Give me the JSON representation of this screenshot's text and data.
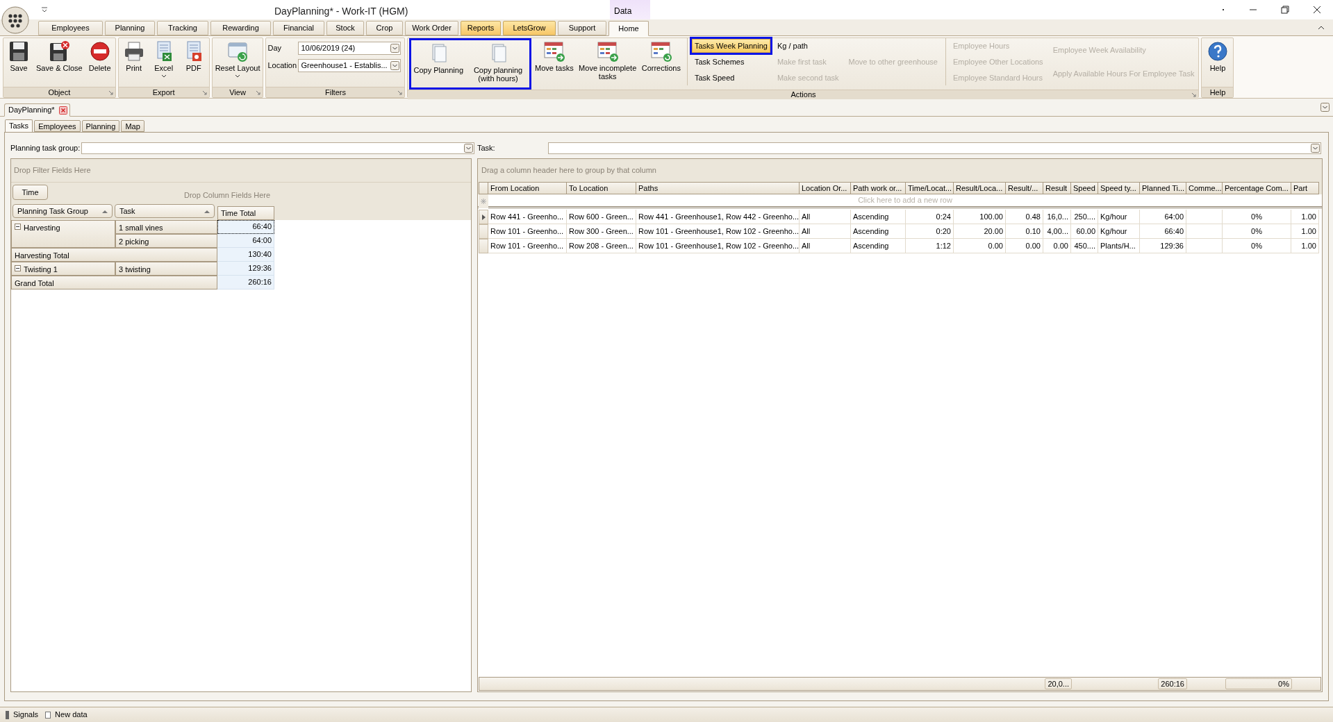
{
  "window": {
    "title": "DayPlanning* - Work-IT (HGM)",
    "context_label": "Data"
  },
  "ribbon_tabs": [
    {
      "label": "Employees",
      "selected": false,
      "highlighted": false
    },
    {
      "label": "Planning",
      "selected": false,
      "highlighted": false
    },
    {
      "label": "Tracking",
      "selected": false,
      "highlighted": false
    },
    {
      "label": "Rewarding",
      "selected": false,
      "highlighted": false
    },
    {
      "label": "Financial",
      "selected": false,
      "highlighted": false
    },
    {
      "label": "Stock",
      "selected": false,
      "highlighted": false
    },
    {
      "label": "Crop",
      "selected": false,
      "highlighted": false
    },
    {
      "label": "Work Order",
      "selected": false,
      "highlighted": false
    },
    {
      "label": "Reports",
      "selected": false,
      "highlighted": true
    },
    {
      "label": "LetsGrow",
      "selected": false,
      "highlighted": true
    },
    {
      "label": "Support",
      "selected": false,
      "highlighted": false
    },
    {
      "label": "Home",
      "selected": true,
      "highlighted": false
    }
  ],
  "ribbon_groups": [
    {
      "caption": "Object",
      "buttons": [
        {
          "label": "Save",
          "kind": "save",
          "dropdown": false,
          "outlined": false
        },
        {
          "label": "Save & Close",
          "kind": "saveclose",
          "dropdown": false,
          "outlined": false
        },
        {
          "label": "Delete",
          "kind": "delete",
          "dropdown": false,
          "outlined": false
        }
      ]
    },
    {
      "caption": "Export",
      "buttons": [
        {
          "label": "Print",
          "kind": "print",
          "dropdown": false,
          "outlined": false
        },
        {
          "label": "Excel",
          "kind": "excel",
          "dropdown": true,
          "outlined": false
        },
        {
          "label": "PDF",
          "kind": "pdf",
          "dropdown": false,
          "outlined": false
        }
      ]
    },
    {
      "caption": "View",
      "buttons": [
        {
          "label": "Reset Layout",
          "kind": "reset",
          "dropdown": true,
          "outlined": false
        }
      ]
    },
    {
      "caption": "Filters",
      "fields": [
        {
          "label": "Day",
          "value": "10/06/2019 (24)"
        },
        {
          "label": "Location",
          "value": "Greenhouse1 - Establis..."
        }
      ]
    },
    {
      "caption": "Actions",
      "buttons": [
        {
          "label": "Copy Planning",
          "kind": "copy",
          "dropdown": false,
          "outlined": true
        },
        {
          "label": "Copy planning (with hours)",
          "kind": "copy",
          "dropdown": false,
          "outlined": true
        },
        {
          "label": "Move tasks",
          "kind": "move",
          "dropdown": false,
          "outlined": false
        },
        {
          "label": "Move incomplete tasks",
          "kind": "move",
          "dropdown": false,
          "outlined": false
        },
        {
          "label": "Corrections",
          "kind": "correct",
          "dropdown": false,
          "outlined": false
        }
      ],
      "sections": [
        {
          "columns": [
            [
              {
                "label": "Tasks Week Planning",
                "disabled": false,
                "highlighted": true,
                "outlined": true
              },
              {
                "label": "Task Schemes",
                "disabled": false,
                "highlighted": false,
                "outlined": false
              },
              {
                "label": "Task Speed",
                "disabled": false,
                "highlighted": false,
                "outlined": false
              }
            ],
            [
              {
                "label": "Kg / path",
                "disabled": false,
                "highlighted": false,
                "outlined": false
              },
              {
                "label": "Make first task",
                "disabled": true,
                "highlighted": false,
                "outlined": false
              },
              {
                "label": "Make second task",
                "disabled": true,
                "highlighted": false,
                "outlined": false
              }
            ],
            [
              {
                "label": "Move to other greenhouse",
                "disabled": true,
                "highlighted": false,
                "outlined": false
              }
            ]
          ]
        },
        {
          "columns": [
            [
              {
                "label": "Employee Hours",
                "disabled": true,
                "highlighted": false,
                "outlined": false
              },
              {
                "label": "Employee Other Locations",
                "disabled": true,
                "highlighted": false,
                "outlined": false
              },
              {
                "label": "Employee Standard Hours",
                "disabled": true,
                "highlighted": false,
                "outlined": false
              }
            ],
            [
              {
                "label": "Employee Week Availability",
                "disabled": true,
                "highlighted": false,
                "outlined": false
              },
              {
                "label": "Apply Available Hours For Employee Task",
                "disabled": true,
                "highlighted": false,
                "outlined": false
              }
            ]
          ]
        }
      ]
    },
    {
      "caption": "Help",
      "buttons": [
        {
          "label": "Help",
          "kind": "help",
          "dropdown": false,
          "outlined": false
        }
      ]
    }
  ],
  "document_tab": {
    "label": "DayPlanning*"
  },
  "view_tabs": [
    {
      "label": "Tasks",
      "selected": true
    },
    {
      "label": "Employees",
      "selected": false
    },
    {
      "label": "Planning",
      "selected": false
    },
    {
      "label": "Map",
      "selected": false
    }
  ],
  "filters": [
    {
      "label": "Planning task group:"
    },
    {
      "label": "Task:"
    }
  ],
  "pivot": {
    "filter_hint": "Drop Filter Fields Here",
    "data_field": "Time",
    "column_hint": "Drop Column Fields Here",
    "row_fields": [
      {
        "label": "Planning Task Group"
      },
      {
        "label": "Task"
      }
    ],
    "data_header": "Time Total",
    "rows": [
      {
        "kind": "group",
        "label": "Harvesting",
        "expanded": true,
        "items": [
          {
            "task": "1 small vines",
            "value": "66:40",
            "focused": true
          },
          {
            "task": "2 picking",
            "value": "64:00",
            "focused": false
          }
        ]
      },
      {
        "kind": "total",
        "label": "Harvesting Total",
        "value": "130:40"
      },
      {
        "kind": "group",
        "label": "Twisting 1",
        "expanded": true,
        "items": [
          {
            "task": "3 twisting",
            "value": "129:36",
            "focused": false
          }
        ]
      },
      {
        "kind": "total",
        "label": "Grand Total",
        "value": "260:16"
      }
    ]
  },
  "grid": {
    "group_hint": "Drag a column header here to group by that column",
    "new_row_hint": "Click here to add a new row",
    "columns": [
      {
        "label": "From Location",
        "kind": "text"
      },
      {
        "label": "To Location",
        "kind": "text"
      },
      {
        "label": "Paths",
        "kind": "text"
      },
      {
        "label": "Location Or...",
        "kind": "text"
      },
      {
        "label": "Path work or...",
        "kind": "text"
      },
      {
        "label": "Time/Locat...",
        "kind": "number"
      },
      {
        "label": "Result/Loca...",
        "kind": "number"
      },
      {
        "label": "Result/...",
        "kind": "number"
      },
      {
        "label": "Result",
        "kind": "number",
        "summary": "20,0..."
      },
      {
        "label": "Speed",
        "kind": "number"
      },
      {
        "label": "Speed ty...",
        "kind": "text"
      },
      {
        "label": "Planned Ti...",
        "kind": "number",
        "summary": "260:16"
      },
      {
        "label": "Comme...",
        "kind": "text"
      },
      {
        "label": "Percentage Com...",
        "kind": "center",
        "summary": "0%"
      },
      {
        "label": "Part",
        "kind": "number"
      }
    ],
    "rows": [
      {
        "current": true,
        "cells": [
          "Row 441 - Greenho...",
          "Row 600 - Green...",
          "Row 441 - Greenhouse1, Row 442 - Greenho...",
          "All",
          "Ascending",
          "0:24",
          "100.00",
          "0.48",
          "16,0...",
          "250....",
          "Kg/hour",
          "64:00",
          null,
          "0%",
          "1.00"
        ]
      },
      {
        "current": false,
        "cells": [
          "Row 101 - Greenho...",
          "Row 300 - Green...",
          "Row 101 - Greenhouse1, Row 102 - Greenho...",
          "All",
          "Ascending",
          "0:20",
          "20.00",
          "0.10",
          "4,00...",
          "60.00",
          "Kg/hour",
          "66:40",
          null,
          "0%",
          "1.00"
        ]
      },
      {
        "current": false,
        "cells": [
          "Row 101 - Greenho...",
          "Row 208 - Green...",
          "Row 101 - Greenhouse1, Row 102 - Greenho...",
          "All",
          "Ascending",
          "1:12",
          "0.00",
          "0.00",
          "0.00",
          "450....",
          "Plants/H...",
          "129:36",
          null,
          "0%",
          "1.00"
        ]
      }
    ]
  },
  "status_bar": [
    {
      "label": "Signals"
    },
    {
      "label": "New data"
    }
  ]
}
